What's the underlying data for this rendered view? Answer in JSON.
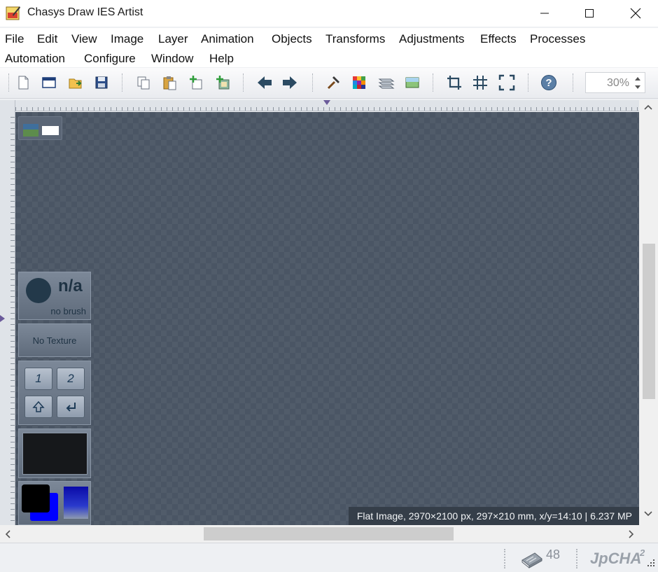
{
  "window": {
    "title": "Chasys Draw IES Artist"
  },
  "menu": {
    "row1": [
      "File",
      "Edit",
      "View",
      "Image",
      "Layer",
      "Animation",
      "Objects",
      "Transforms",
      "Adjustments",
      "Effects",
      "Processes"
    ],
    "row2": [
      "Automation",
      "Configure",
      "Window",
      "Help"
    ]
  },
  "toolbar": {
    "buttons": [
      "new-document-icon",
      "new-window-icon",
      "open-icon",
      "save-icon",
      "copy-icon",
      "paste-icon",
      "add-layer-icon",
      "paste-as-layer-icon",
      "undo-arrow-icon",
      "redo-arrow-icon",
      "hammer-icon",
      "palette-icon",
      "layers-icon",
      "image-icon",
      "crop-icon",
      "grid-icon",
      "fullscreen-icon",
      "help-icon"
    ],
    "zoom": "30%"
  },
  "tool_panels": {
    "brush_value": "n/a",
    "brush_label": "no brush",
    "texture_label": "No Texture",
    "key1": "1",
    "key2": "2"
  },
  "colors": {
    "canvas": "#4a5564",
    "primary": "#000000",
    "secondary": "#0000ff"
  },
  "status": {
    "image_info": "Flat Image, 2970×2100 px, 297×210 mm, x/y=14:10 | 6.237 MP",
    "memory_count": "48",
    "brand": "JpCHA",
    "brand_sup": "2"
  }
}
